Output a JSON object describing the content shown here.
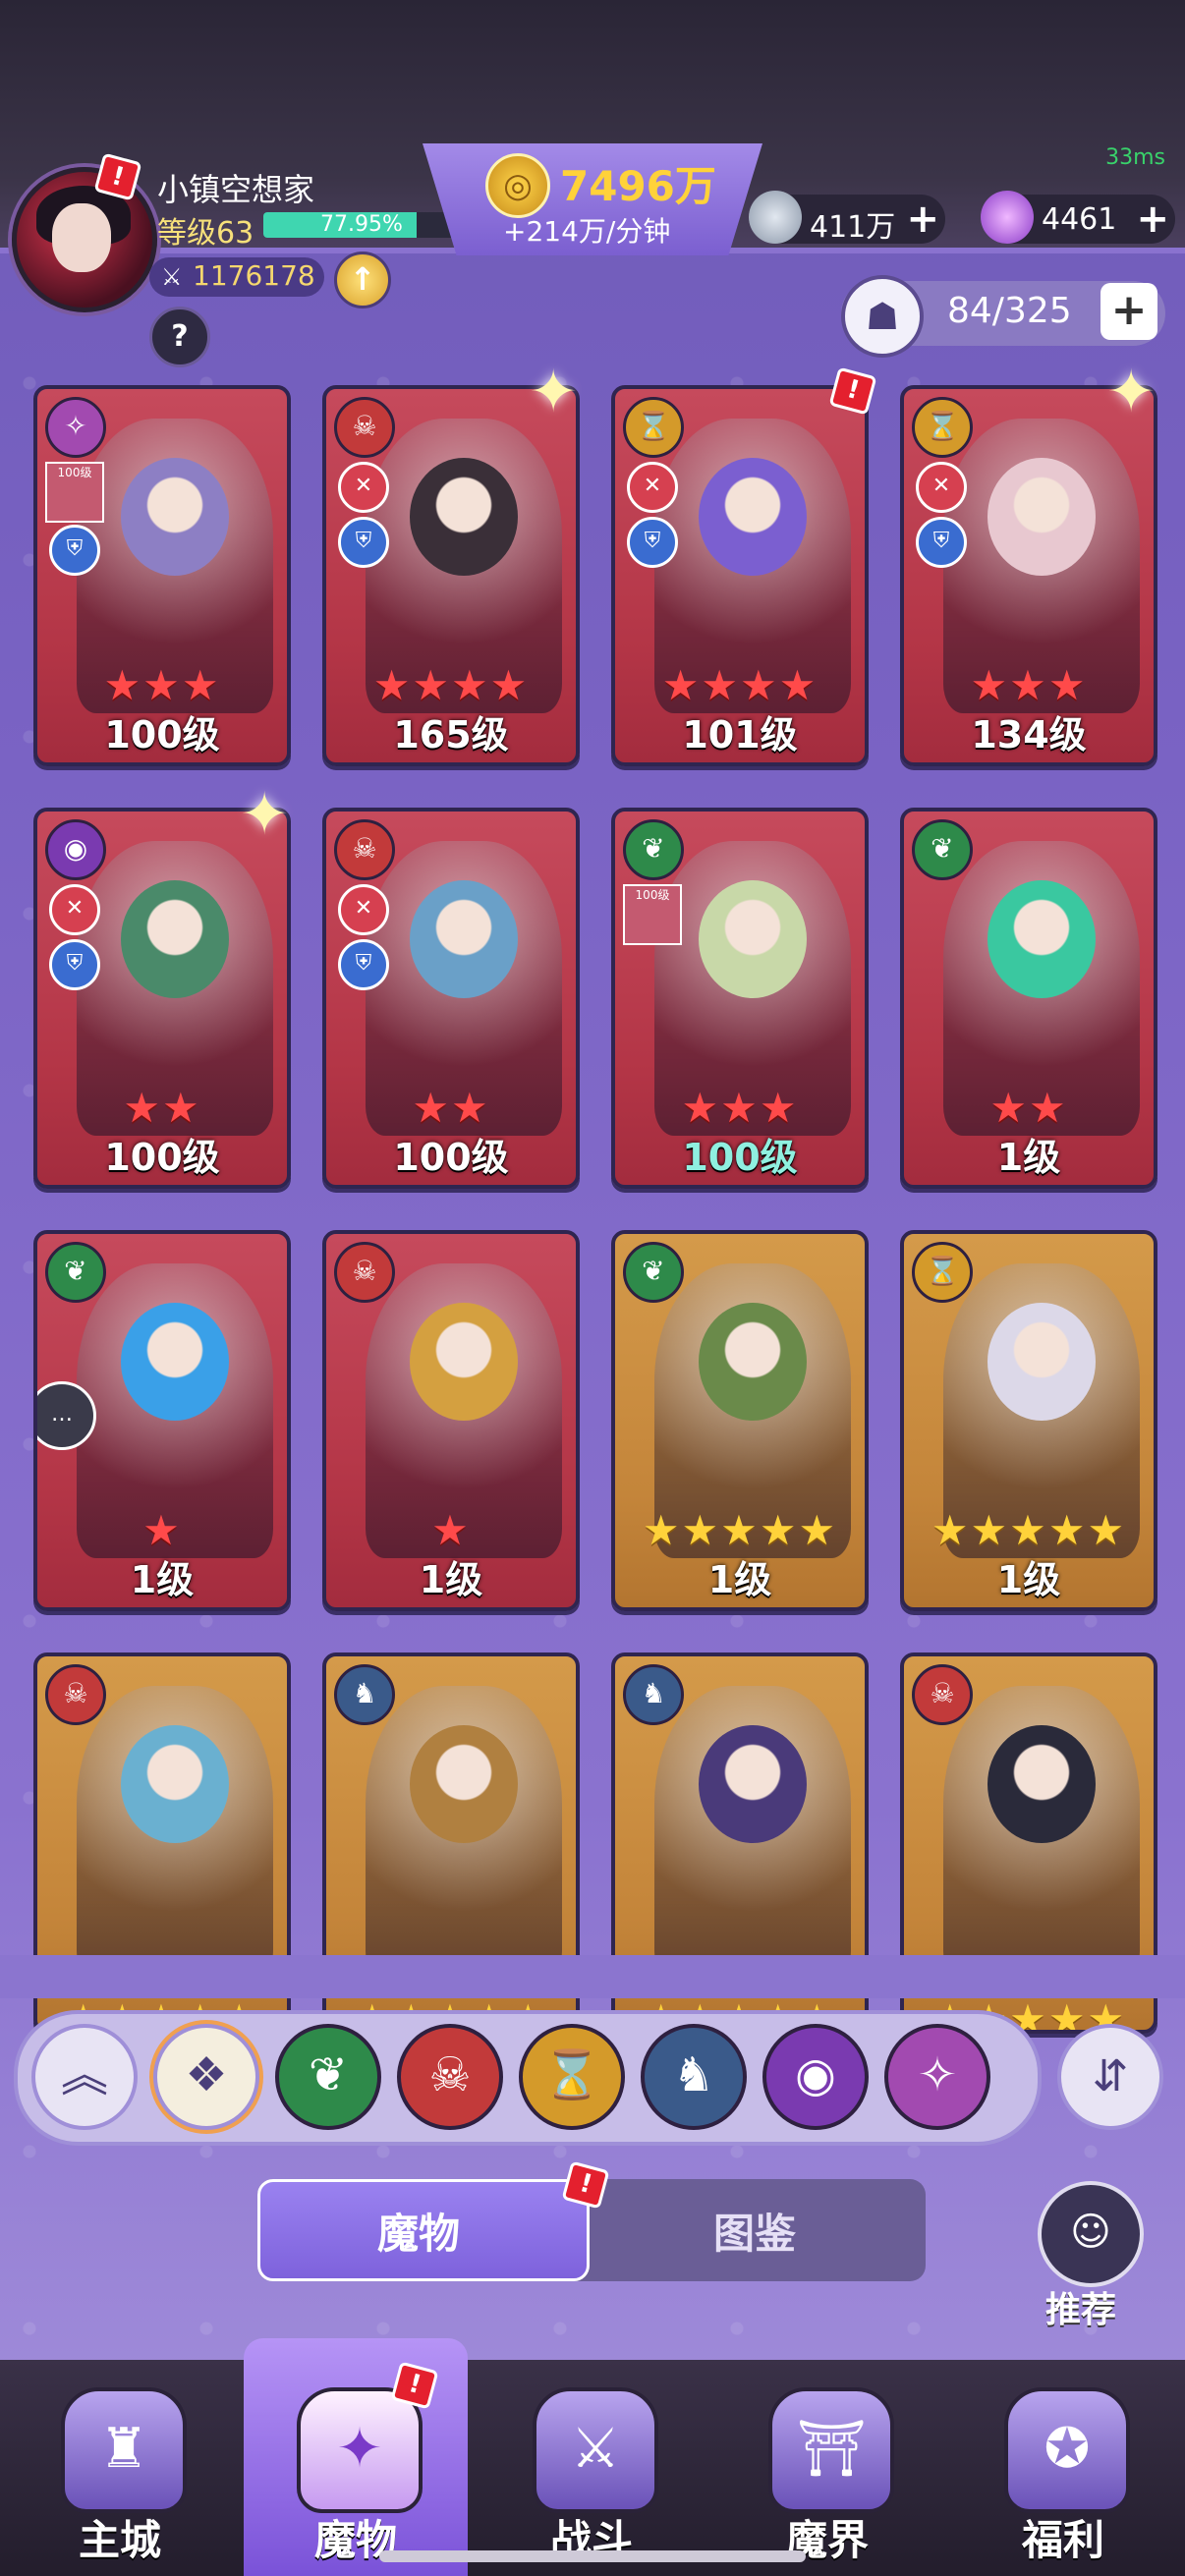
{
  "status": {
    "latency": "33ms"
  },
  "player": {
    "name": "小镇空想家",
    "level": "等级63",
    "xp_percent": 77.95,
    "xp_text": "77.95%",
    "power": "1176178"
  },
  "gold": {
    "amount": "7496万",
    "rate": "+214万/分钟"
  },
  "resources": [
    {
      "name": "silver-coin",
      "amount": "411万",
      "color": "#9aa6b8"
    },
    {
      "name": "crystal",
      "amount": "4461",
      "color": "#c06adc"
    }
  ],
  "capacity": {
    "text": "84/325"
  },
  "monsters": [
    {
      "faction": "arcane",
      "level": "100级",
      "stars": 3,
      "star_color": "red",
      "frame": "red",
      "sword": false,
      "shield": true,
      "mini": "100级",
      "art": "#8d7fc4"
    },
    {
      "faction": "demon",
      "level": "165级",
      "stars": 4,
      "star_color": "red",
      "frame": "red",
      "sword": true,
      "shield": true,
      "sparkle": true,
      "art": "#3a2f38"
    },
    {
      "faction": "time",
      "level": "101级",
      "stars": 4,
      "star_color": "red",
      "frame": "red",
      "sword": true,
      "shield": true,
      "notif": true,
      "art": "#7b5fd0"
    },
    {
      "faction": "time",
      "level": "134级",
      "stars": 3,
      "star_color": "red",
      "frame": "red",
      "sword": true,
      "shield": true,
      "sparkle": true,
      "art": "#e8c8d0"
    },
    {
      "faction": "eye",
      "level": "100级",
      "stars": 2,
      "star_color": "red",
      "frame": "red",
      "sword": true,
      "shield": true,
      "sparkle": true,
      "art": "#4a8a6a"
    },
    {
      "faction": "demon",
      "level": "100级",
      "stars": 2,
      "star_color": "red",
      "frame": "red",
      "sword": true,
      "shield": true,
      "art": "#6aa0c8"
    },
    {
      "faction": "nature",
      "level": "100级",
      "stars": 3,
      "star_color": "red",
      "frame": "red",
      "mini": "100级",
      "level_teal": true,
      "art": "#c8d8a8"
    },
    {
      "faction": "nature",
      "level": "1级",
      "stars": 2,
      "star_color": "red",
      "frame": "red",
      "art": "#3ac8a0"
    },
    {
      "faction": "nature",
      "level": "1级",
      "stars": 1,
      "star_color": "red",
      "frame": "red",
      "chat": true,
      "art": "#3aa0e8"
    },
    {
      "faction": "demon",
      "level": "1级",
      "stars": 1,
      "star_color": "red",
      "frame": "red",
      "art": "#d4a040"
    },
    {
      "faction": "nature",
      "level": "1级",
      "stars": 5,
      "star_color": "gold",
      "frame": "gold",
      "art": "#6a8a4a"
    },
    {
      "faction": "time",
      "level": "1级",
      "stars": 5,
      "star_color": "gold",
      "frame": "gold",
      "art": "#dcd8e8"
    },
    {
      "faction": "demon",
      "level": "",
      "stars": 5,
      "star_color": "gold",
      "frame": "gold",
      "art": "#6ab0d0"
    },
    {
      "faction": "dragon",
      "level": "",
      "stars": 5,
      "star_color": "gold",
      "frame": "gold",
      "art": "#b08040"
    },
    {
      "faction": "dragon",
      "level": "",
      "stars": 5,
      "star_color": "gold",
      "frame": "gold",
      "art": "#4a3a7a"
    },
    {
      "faction": "demon",
      "level": "",
      "stars": 5,
      "star_color": "gold",
      "frame": "gold",
      "art": "#2a2a3a"
    }
  ],
  "factions": {
    "arcane": {
      "color": "#a24ab0",
      "glyph": "✧"
    },
    "demon": {
      "color": "#c23a3a",
      "glyph": "☠"
    },
    "time": {
      "color": "#d49a2a",
      "glyph": "⌛"
    },
    "eye": {
      "color": "#7a3ab0",
      "glyph": "◉"
    },
    "nature": {
      "color": "#2e8a4a",
      "glyph": "❦"
    },
    "dragon": {
      "color": "#3a5a8a",
      "glyph": "♞"
    }
  },
  "filters": [
    {
      "name": "collapse",
      "glyph": "︽",
      "color": "#e8e4f4"
    },
    {
      "name": "all",
      "glyph": "❖",
      "color": "#f4eede"
    },
    {
      "name": "nature",
      "glyph": "❦",
      "color": "#2e8a4a"
    },
    {
      "name": "demon",
      "glyph": "☠",
      "color": "#c23a3a"
    },
    {
      "name": "time",
      "glyph": "⌛",
      "color": "#d49a2a"
    },
    {
      "name": "dragon",
      "glyph": "♞",
      "color": "#3a5a8a"
    },
    {
      "name": "eye",
      "glyph": "◉",
      "color": "#7a3ab0"
    },
    {
      "name": "arcane",
      "glyph": "✧",
      "color": "#a24ab0"
    }
  ],
  "tabs": {
    "monsters": "魔物",
    "codex": "图鉴"
  },
  "recommend": "推荐",
  "nav": [
    {
      "key": "city",
      "label": "主城",
      "glyph": "♜"
    },
    {
      "key": "monster",
      "label": "魔物",
      "glyph": "✦",
      "active": true,
      "notif": true
    },
    {
      "key": "battle",
      "label": "战斗",
      "glyph": "⚔"
    },
    {
      "key": "realm",
      "label": "魔界",
      "glyph": "⛩"
    },
    {
      "key": "welfare",
      "label": "福利",
      "glyph": "✪"
    }
  ]
}
